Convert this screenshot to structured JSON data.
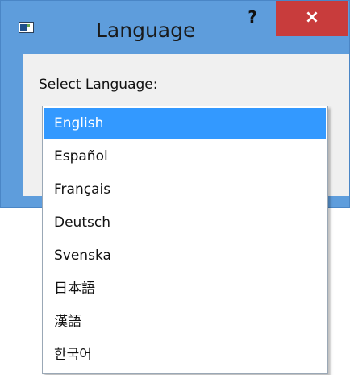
{
  "window": {
    "title": "Language",
    "help_label": "?",
    "close_label": "×"
  },
  "content": {
    "select_label": "Select Language:"
  },
  "dropdown": {
    "selected_index": 0,
    "options": [
      "English",
      "Español",
      "Français",
      "Deutsch",
      "Svenska",
      "日本語",
      "漢語",
      "한국어"
    ]
  },
  "colors": {
    "title_bar": "#5e9ddc",
    "close_button": "#c83c3c",
    "selection": "#3399ff"
  }
}
